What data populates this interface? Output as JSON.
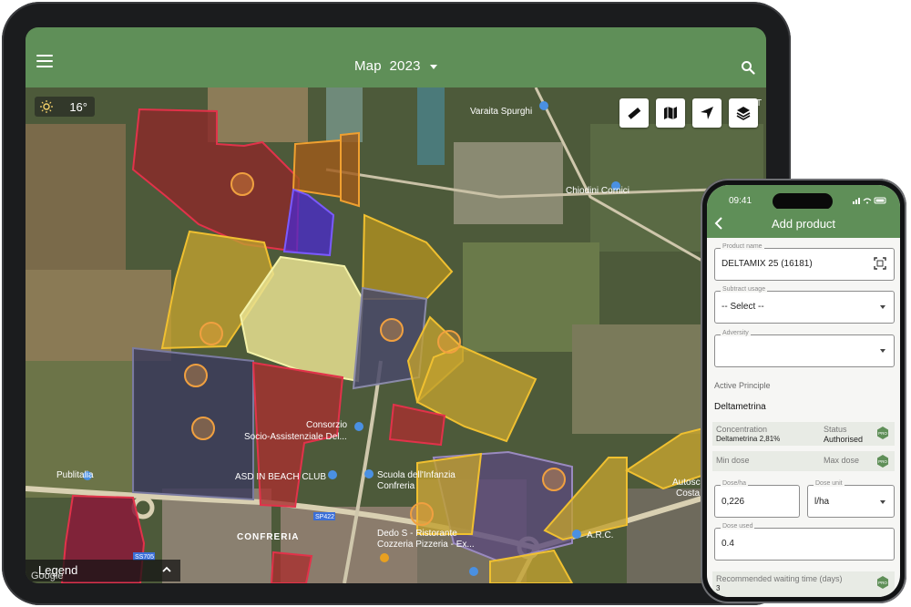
{
  "tablet": {
    "header": {
      "title": "Map",
      "year": "2023"
    },
    "weather": {
      "temperature": "16°",
      "icon": "sun-icon"
    },
    "tools": [
      "ruler-icon",
      "map-icon",
      "navigation-icon",
      "layers-icon"
    ],
    "map_labels": {
      "varaita": "Varaita Spurghi",
      "chiodini": "Chiodini Cornici",
      "consorzio": "Consorzio",
      "socio": "Socio-Assistenziale Del...",
      "asd": "ASD IN BEACH CLUB",
      "scuola1": "Scuola dell'Infanzia",
      "scuola2": "Confreria",
      "publitalia": "Publitalia",
      "confreria": "CONFRERIA",
      "dedo1": "Dedo S - Ristorante",
      "dedo2": "Cozzeria Pizzeria - Ex...",
      "arc": "A.R.C.",
      "autosc1": "Autosc",
      "autosc2": "Costa",
      "road1": "SP422",
      "road2": "SS705",
      "edge_t": "T"
    },
    "legend": {
      "label": "Legend"
    },
    "google": "Google"
  },
  "phone": {
    "status": {
      "time": "09:41"
    },
    "title": "Add product",
    "product_name": {
      "label": "Product name",
      "value": "DELTAMIX 25 (16181)"
    },
    "subtract_usage": {
      "label": "Subtract usage",
      "value": "-- Select --"
    },
    "adversity": {
      "label": "Adversity",
      "value": ""
    },
    "active_principle": {
      "label": "Active Principle",
      "value": "Deltametrina"
    },
    "concentration": {
      "label": "Concentration",
      "value": "Deltametrina 2,81%",
      "status_label": "Status",
      "status_value": "Authorised",
      "badge": "PRO"
    },
    "dose_row": {
      "min_label": "Min dose",
      "max_label": "Max dose",
      "badge": "PRO"
    },
    "dose_ha": {
      "label": "Dose/ha",
      "value": "0,226"
    },
    "dose_unit": {
      "label": "Dose unit",
      "value": "l/ha"
    },
    "dose_used": {
      "label": "Dose used",
      "value": "0.4"
    },
    "waiting": {
      "label": "Recommended waiting time (days)",
      "value": "3",
      "badge": "PRO"
    }
  }
}
